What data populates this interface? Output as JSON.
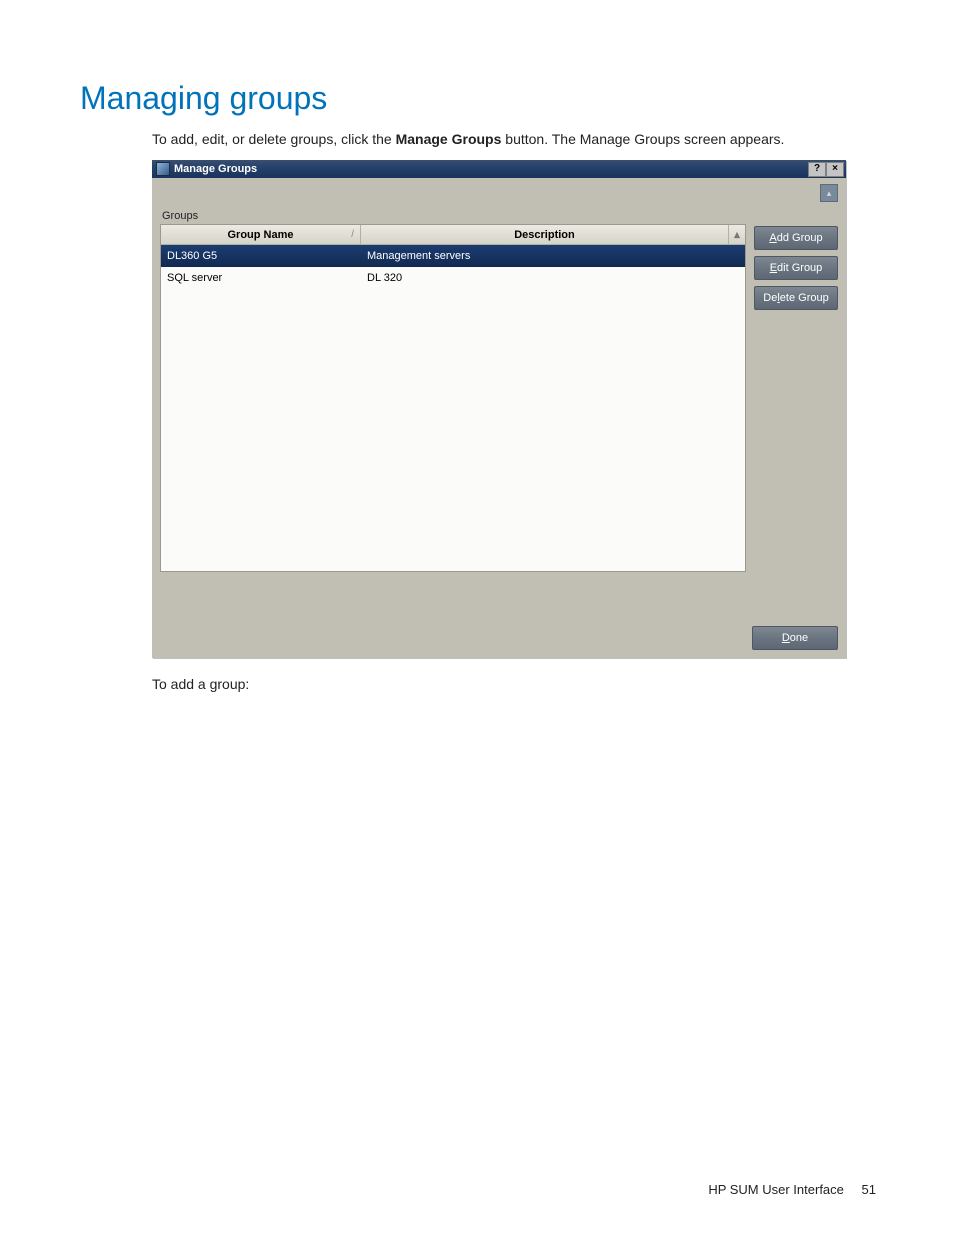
{
  "heading": "Managing groups",
  "intro_pre": "To add, edit, or delete groups, click the ",
  "intro_bold": "Manage Groups",
  "intro_post": " button. The Manage Groups screen appears.",
  "after_text": "To add a group:",
  "window": {
    "title": "Manage Groups",
    "help_btn": "?",
    "close_btn": "×",
    "groups_label": "Groups",
    "columns": {
      "name": "Group Name",
      "desc": "Description",
      "sort": "/"
    },
    "rows": [
      {
        "name": "DL360 G5",
        "desc": "Management servers",
        "selected": true
      },
      {
        "name": "SQL server",
        "desc": "DL 320",
        "selected": false
      }
    ],
    "buttons": {
      "add_u": "A",
      "add_rest": "dd Group",
      "edit_u": "E",
      "edit_rest": "dit Group",
      "delete_pre": "De",
      "delete_u": "l",
      "delete_rest": "ete Group",
      "done_u": "D",
      "done_rest": "one"
    }
  },
  "footer": {
    "text": "HP SUM User Interface",
    "page": "51"
  }
}
